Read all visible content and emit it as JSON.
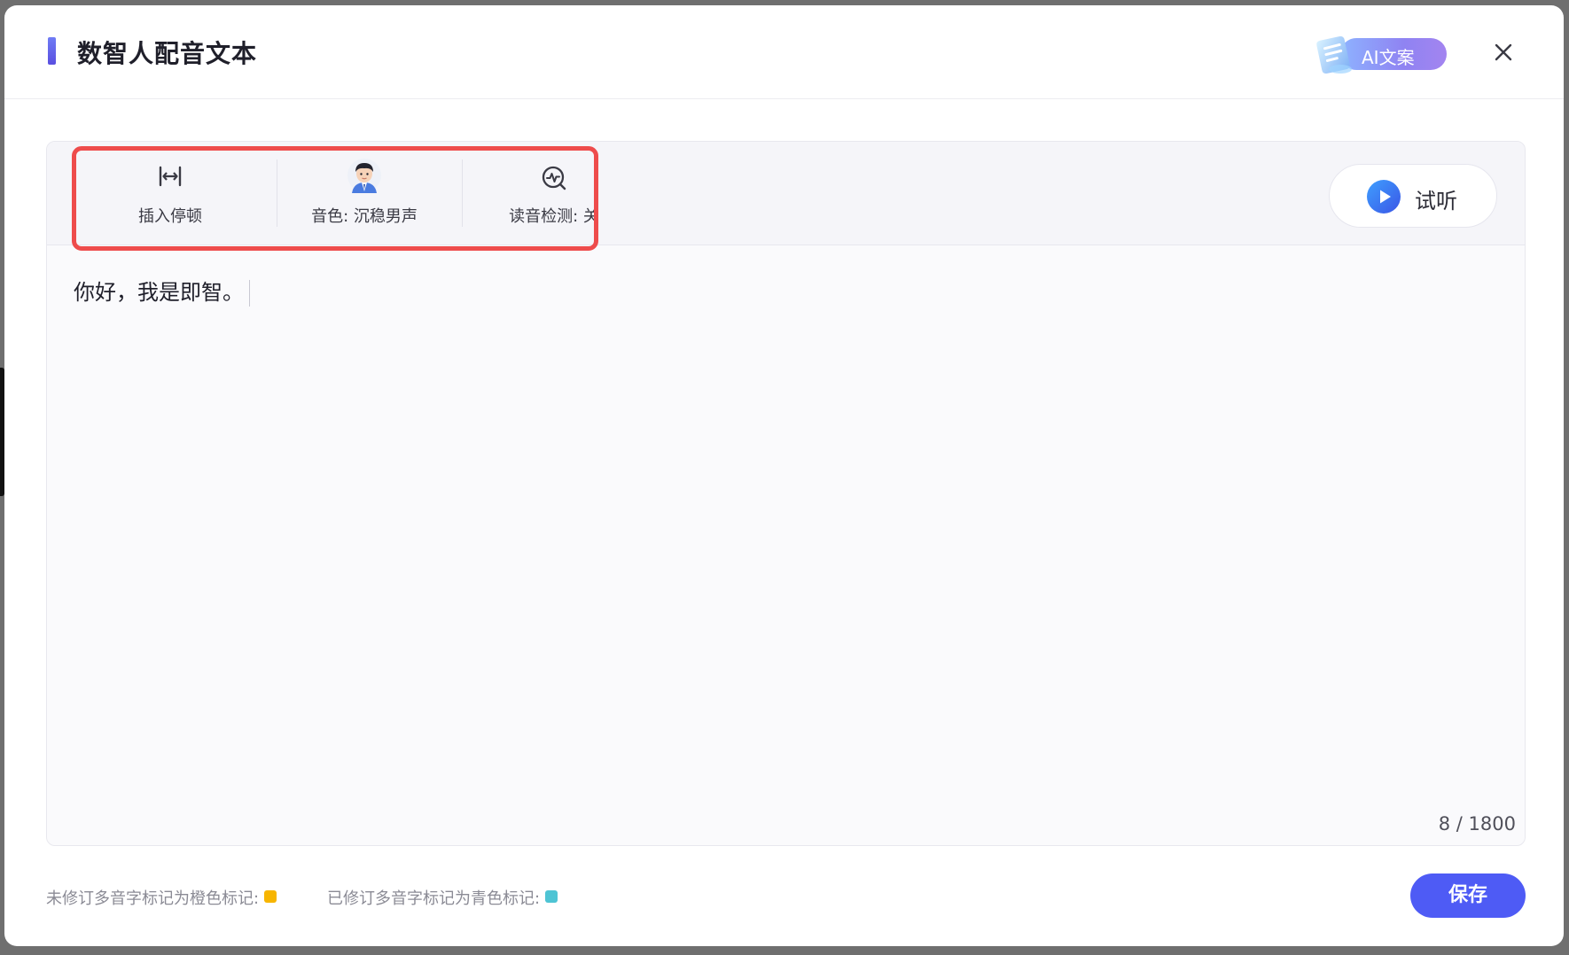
{
  "dialog": {
    "title": "数智人配音文本",
    "ai_button_label": "AI文案",
    "close_icon": "close-icon"
  },
  "toolbar": {
    "insert_pause": {
      "label": "插入停顿",
      "icon": "pause-insert-icon"
    },
    "voice": {
      "label": "音色: 沉稳男声",
      "icon": "male-voice-avatar"
    },
    "pronunciation_check": {
      "label": "读音检测: 关",
      "icon": "pronunciation-check-icon"
    },
    "listen": {
      "label": "试听",
      "icon": "play-icon"
    }
  },
  "editor": {
    "content": "你好，我是即智。",
    "counter": "8 / 1800"
  },
  "legend": {
    "unrevised_label": "未修订多音字标记为橙色标记:",
    "unrevised_color": "#f7b500",
    "revised_label": "已修订多音字标记为青色标记:",
    "revised_color": "#4ec4d4"
  },
  "footer": {
    "save_label": "保存"
  },
  "colors": {
    "accent": "#4e5bf5",
    "highlight": "#ee4c4c"
  }
}
